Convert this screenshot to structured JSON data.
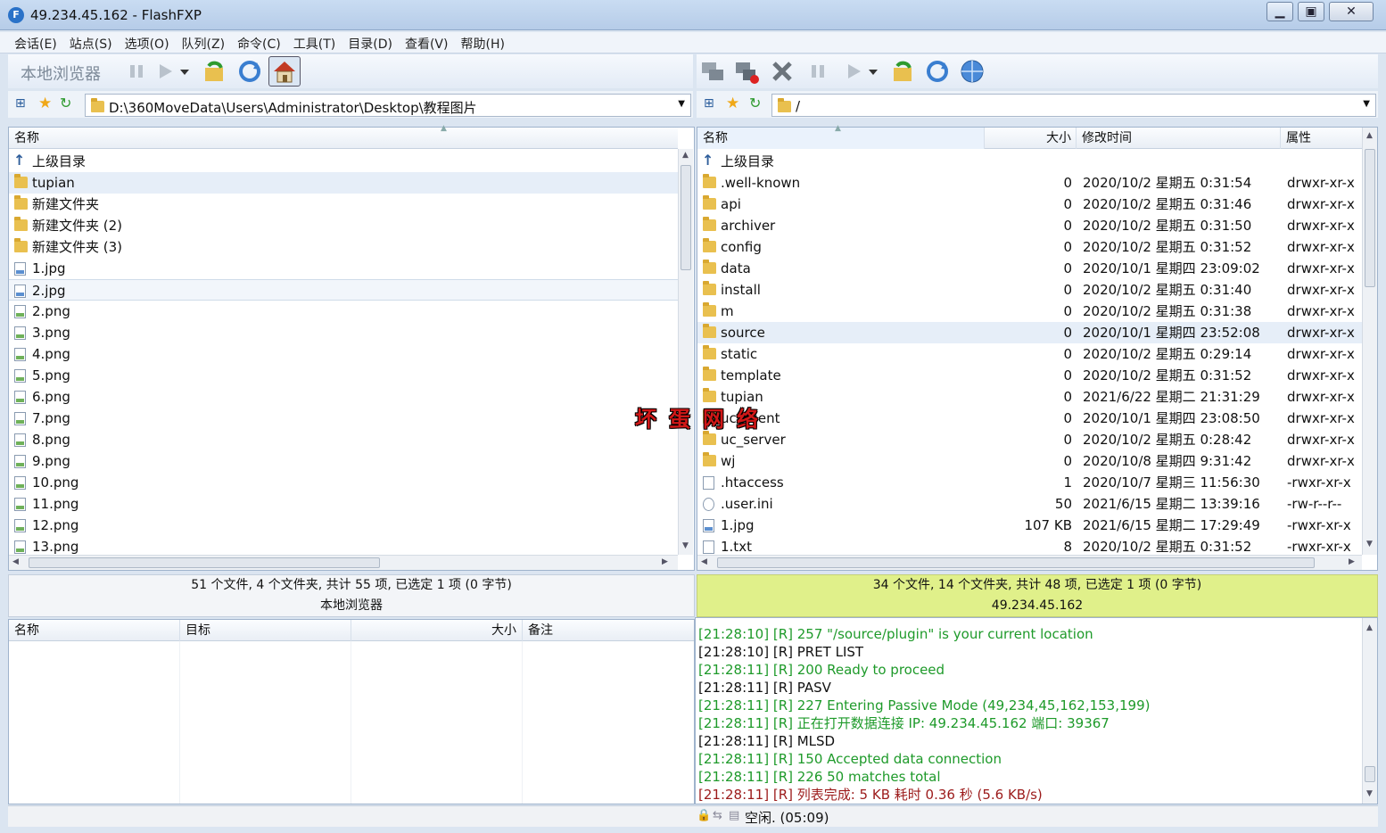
{
  "window": {
    "title": "49.234.45.162 - FlashFXP",
    "icon": "flashfxp-logo-icon"
  },
  "menu": [
    "会话(E)",
    "站点(S)",
    "选项(O)",
    "队列(Z)",
    "命令(C)",
    "工具(T)",
    "目录(D)",
    "查看(V)",
    "帮助(H)"
  ],
  "local": {
    "toolbar_label": "本地浏览器",
    "path": "D:\\360MoveData\\Users\\Administrator\\Desktop\\教程图片",
    "header": {
      "name": "名称"
    },
    "items": [
      {
        "name": "上级目录",
        "type": "up"
      },
      {
        "name": "tupian",
        "type": "folder"
      },
      {
        "name": "新建文件夹",
        "type": "folder"
      },
      {
        "name": "新建文件夹 (2)",
        "type": "folder"
      },
      {
        "name": "新建文件夹 (3)",
        "type": "folder"
      },
      {
        "name": "1.jpg",
        "type": "jpg"
      },
      {
        "name": "2.jpg",
        "type": "jpg"
      },
      {
        "name": "2.png",
        "type": "png"
      },
      {
        "name": "3.png",
        "type": "png"
      },
      {
        "name": "4.png",
        "type": "png"
      },
      {
        "name": "5.png",
        "type": "png"
      },
      {
        "name": "6.png",
        "type": "png"
      },
      {
        "name": "7.png",
        "type": "png"
      },
      {
        "name": "8.png",
        "type": "png"
      },
      {
        "name": "9.png",
        "type": "png"
      },
      {
        "name": "10.png",
        "type": "png"
      },
      {
        "name": "11.png",
        "type": "png"
      },
      {
        "name": "12.png",
        "type": "png"
      },
      {
        "name": "13.png",
        "type": "png"
      }
    ],
    "status": "51 个文件, 4 个文件夹, 共计 55 项, 已选定 1 项 (0 字节)",
    "status_name": "本地浏览器"
  },
  "remote": {
    "path": "/",
    "header": {
      "name": "名称",
      "size": "大小",
      "modified": "修改时间",
      "attr": "属性"
    },
    "items": [
      {
        "name": "上级目录",
        "type": "up",
        "size": "",
        "modified": "",
        "attr": ""
      },
      {
        "name": ".well-known",
        "type": "folder",
        "size": "0",
        "modified": "2020/10/2 星期五 0:31:54",
        "attr": "drwxr-xr-x"
      },
      {
        "name": "api",
        "type": "folder",
        "size": "0",
        "modified": "2020/10/2 星期五 0:31:46",
        "attr": "drwxr-xr-x"
      },
      {
        "name": "archiver",
        "type": "folder",
        "size": "0",
        "modified": "2020/10/2 星期五 0:31:50",
        "attr": "drwxr-xr-x"
      },
      {
        "name": "config",
        "type": "folder",
        "size": "0",
        "modified": "2020/10/2 星期五 0:31:52",
        "attr": "drwxr-xr-x"
      },
      {
        "name": "data",
        "type": "folder",
        "size": "0",
        "modified": "2020/10/1 星期四 23:09:02",
        "attr": "drwxr-xr-x"
      },
      {
        "name": "install",
        "type": "folder",
        "size": "0",
        "modified": "2020/10/2 星期五 0:31:40",
        "attr": "drwxr-xr-x"
      },
      {
        "name": "m",
        "type": "folder",
        "size": "0",
        "modified": "2020/10/2 星期五 0:31:38",
        "attr": "drwxr-xr-x"
      },
      {
        "name": "source",
        "type": "folder",
        "size": "0",
        "modified": "2020/10/1 星期四 23:52:08",
        "attr": "drwxr-xr-x"
      },
      {
        "name": "static",
        "type": "folder",
        "size": "0",
        "modified": "2020/10/2 星期五 0:29:14",
        "attr": "drwxr-xr-x"
      },
      {
        "name": "template",
        "type": "folder",
        "size": "0",
        "modified": "2020/10/2 星期五 0:31:52",
        "attr": "drwxr-xr-x"
      },
      {
        "name": "tupian",
        "type": "folder",
        "size": "0",
        "modified": "2021/6/22 星期二 21:31:29",
        "attr": "drwxr-xr-x"
      },
      {
        "name": "uc_client",
        "type": "folder",
        "size": "0",
        "modified": "2020/10/1 星期四 23:08:50",
        "attr": "drwxr-xr-x"
      },
      {
        "name": "uc_server",
        "type": "folder",
        "size": "0",
        "modified": "2020/10/2 星期五 0:28:42",
        "attr": "drwxr-xr-x"
      },
      {
        "name": "wj",
        "type": "folder",
        "size": "0",
        "modified": "2020/10/8 星期四 9:31:42",
        "attr": "drwxr-xr-x"
      },
      {
        "name": ".htaccess",
        "type": "file",
        "size": "1",
        "modified": "2020/10/7 星期三 11:56:30",
        "attr": "-rwxr-xr-x"
      },
      {
        "name": ".user.ini",
        "type": "ini",
        "size": "50",
        "modified": "2021/6/15 星期二 13:39:16",
        "attr": "-rw-r--r--"
      },
      {
        "name": "1.jpg",
        "type": "jpg",
        "size": "107 KB",
        "modified": "2021/6/15 星期二 17:29:49",
        "attr": "-rwxr-xr-x"
      },
      {
        "name": "1.txt",
        "type": "file",
        "size": "8",
        "modified": "2020/10/2 星期五 0:31:52",
        "attr": "-rwxr-xr-x"
      }
    ],
    "status": "34 个文件, 14 个文件夹, 共计 48 项, 已选定 1 项 (0 字节)",
    "status_name": "49.234.45.162"
  },
  "queue": {
    "headers": [
      "名称",
      "目标",
      "大小",
      "备注"
    ]
  },
  "log": [
    {
      "text": "[21:28:10] [R] 257 \"/source/plugin\" is your current location",
      "color": "green"
    },
    {
      "text": "[21:28:10] [R] PRET LIST",
      "color": "black"
    },
    {
      "text": "[21:28:11] [R] 200 Ready to proceed",
      "color": "green"
    },
    {
      "text": "[21:28:11] [R] PASV",
      "color": "black"
    },
    {
      "text": "[21:28:11] [R] 227 Entering Passive Mode (49,234,45,162,153,199)",
      "color": "green"
    },
    {
      "text": "[21:28:11] [R] 正在打开数据连接 IP: 49.234.45.162 端口: 39367",
      "color": "green"
    },
    {
      "text": "[21:28:11] [R] MLSD",
      "color": "black"
    },
    {
      "text": "[21:28:11] [R] 150 Accepted data connection",
      "color": "green"
    },
    {
      "text": "[21:28:11] [R] 226 50 matches total",
      "color": "green"
    },
    {
      "text": "[21:28:11] [R] 列表完成: 5 KB 耗时 0.36 秒 (5.6 KB/s)",
      "color": "red"
    }
  ],
  "bottom_status": "空闲. (05:09)",
  "watermark": "坏蛋网络"
}
